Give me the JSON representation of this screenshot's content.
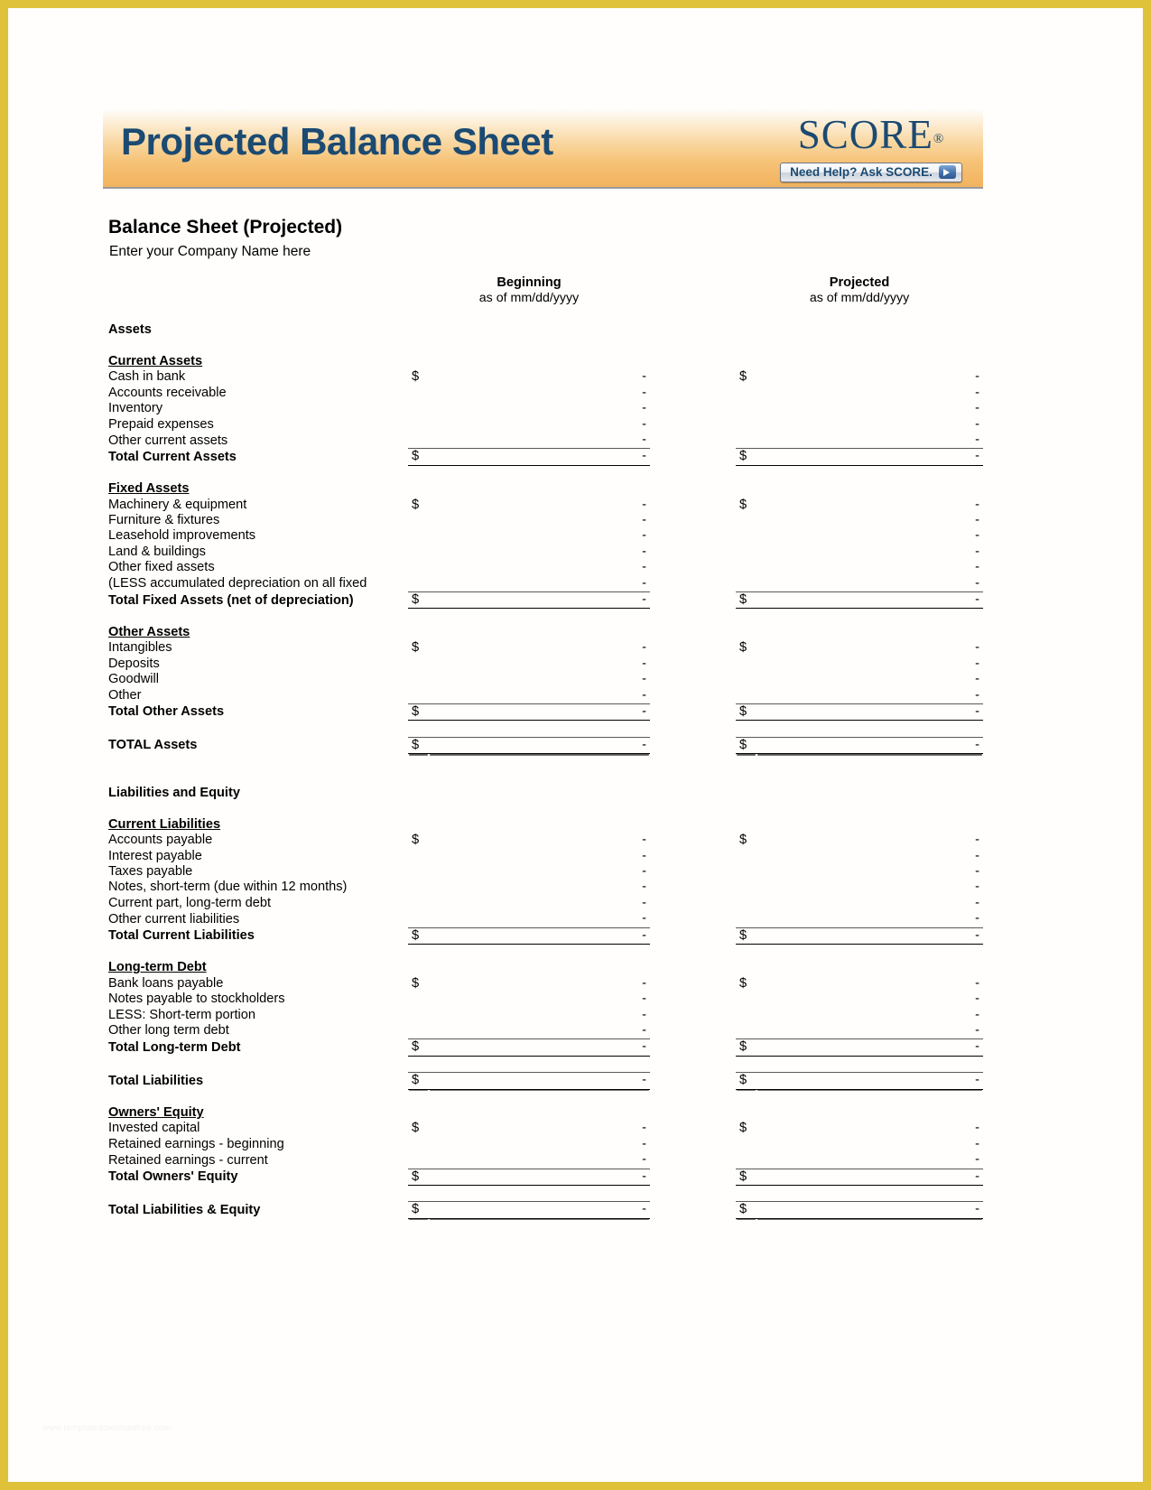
{
  "banner": {
    "title": "Projected Balance Sheet",
    "logo_word": "SCORE",
    "logo_reg": "®",
    "help_button": "Need Help? Ask SCORE.",
    "arrow_icon": "arrow-right-icon"
  },
  "document": {
    "title": "Balance Sheet (Projected)",
    "company_placeholder": "Enter your Company Name here",
    "watermark": "www.templatedownloadfree.com"
  },
  "columns": {
    "beginning": {
      "header": "Beginning",
      "subheader": "as of mm/dd/yyyy"
    },
    "projected": {
      "header": "Projected",
      "subheader": "as of mm/dd/yyyy"
    }
  },
  "currency_symbol": "$",
  "blank_value": "-",
  "sections": {
    "assets_heading": "Assets",
    "liabilities_heading": "Liabilities and Equity",
    "current_assets": {
      "heading": "Current Assets",
      "items": [
        "Cash in bank",
        "Accounts receivable",
        "Inventory",
        "Prepaid expenses",
        "Other current assets"
      ],
      "total_label": "Total Current Assets"
    },
    "fixed_assets": {
      "heading": "Fixed Assets",
      "items": [
        "Machinery & equipment",
        "Furniture & fixtures",
        "Leasehold improvements",
        "Land & buildings",
        "Other fixed assets",
        "(LESS accumulated depreciation on all fixed"
      ],
      "total_label": "Total Fixed Assets (net of depreciation)"
    },
    "other_assets": {
      "heading": "Other Assets",
      "items": [
        "Intangibles",
        "Deposits",
        "Goodwill",
        "Other"
      ],
      "total_label": "Total Other Assets"
    },
    "total_assets_label": "TOTAL Assets",
    "current_liabilities": {
      "heading": "Current Liabilities",
      "items": [
        "Accounts payable",
        "Interest payable",
        "Taxes payable",
        "Notes, short-term (due within 12 months)",
        "Current part, long-term debt",
        "Other current liabilities"
      ],
      "total_label": "Total Current Liabilities"
    },
    "long_term_debt": {
      "heading": "Long-term Debt",
      "items": [
        "Bank loans payable",
        "Notes payable to stockholders",
        "LESS: Short-term portion",
        "Other long term debt"
      ],
      "total_label": "Total Long-term Debt"
    },
    "total_liabilities_label": "Total Liabilities",
    "owners_equity": {
      "heading": "Owners' Equity",
      "items": [
        "Invested capital",
        "Retained earnings - beginning",
        "Retained earnings - current"
      ],
      "total_label": "Total Owners' Equity"
    },
    "total_liab_equity_label": "Total Liabilities & Equity"
  }
}
